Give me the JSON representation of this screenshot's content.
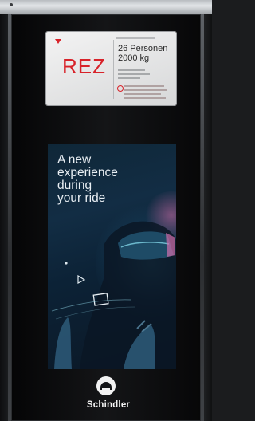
{
  "capacity_plate": {
    "floor": "REZ",
    "persons": "26 Personen",
    "load": "2000 kg"
  },
  "advertisement": {
    "headline_lines": [
      "A new",
      "experience",
      "during",
      "your ride"
    ]
  },
  "brand": {
    "name": "Schindler"
  },
  "colors": {
    "floor_text": "#d8232a",
    "panel": "#0e0f11",
    "plate": "#e6e7e8"
  }
}
